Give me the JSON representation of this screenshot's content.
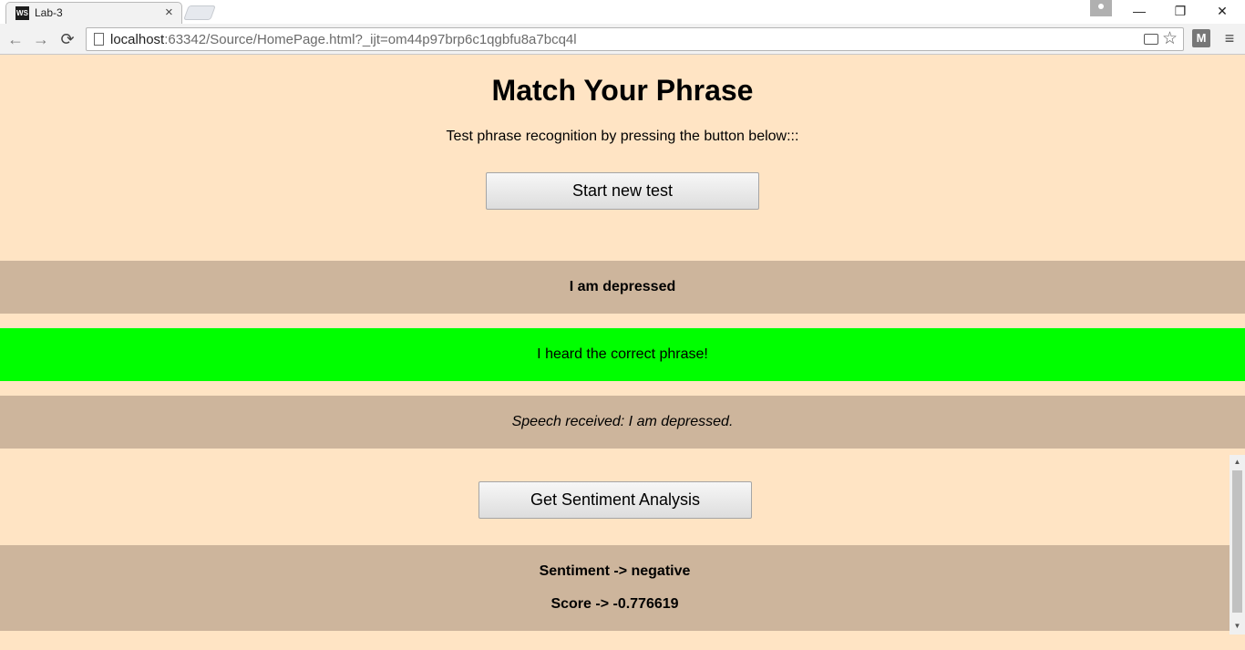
{
  "browser": {
    "tab_title": "Lab-3",
    "tab_favicon_text": "WS",
    "tab_close": "×",
    "url_host": "localhost",
    "url_rest": ":63342/Source/HomePage.html?_ijt=om44p97brp6c1qgbfu8a7bcq4l",
    "extension_label": "M",
    "minimize": "—",
    "maximize": "❐",
    "close": "✕",
    "back": "←",
    "forward": "→",
    "reload": "⟳",
    "star": "☆",
    "menu": "≡"
  },
  "page": {
    "title": "Match Your Phrase",
    "intro": "Test phrase recognition by pressing the button below:::",
    "start_button": "Start new test",
    "phrase": "I am depressed",
    "result": "I heard the correct phrase!",
    "speech_received": "Speech received: I am depressed.",
    "sentiment_button": "Get Sentiment Analysis",
    "sentiment": "Sentiment -> negative",
    "score": "Score -> -0.776619"
  },
  "colors": {
    "page_bg": "#ffe4c4",
    "band_bg": "#cdb59c",
    "success_bg": "#00ff00"
  },
  "icons": {
    "scroll_up": "▲",
    "scroll_down": "▼"
  }
}
